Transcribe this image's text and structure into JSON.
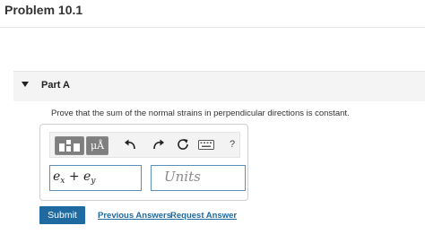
{
  "problem": {
    "title": "Problem 10.1"
  },
  "part": {
    "label": "Part A"
  },
  "question": {
    "text": "Prove that the sum of the normal strains in perpendicular directions is constant."
  },
  "toolbar": {
    "templates_icon": "templates-icon",
    "units_button_label": "μÅ",
    "undo_icon": "undo-icon",
    "redo_icon": "redo-icon",
    "reset_icon": "reset-icon",
    "keyboard_icon": "keyboard-icon",
    "help_label": "?"
  },
  "answer": {
    "expression": {
      "e1": "e",
      "s1": "x",
      "op": "+",
      "e2": "e",
      "s2": "y"
    },
    "units_placeholder": "Units"
  },
  "actions": {
    "submit_label": "Submit",
    "previous_answers_label": "Previous Answers",
    "request_answer_label": "Request Answer"
  },
  "colors": {
    "accent": "#1f6aa1",
    "toolbar_button": "#7f7f7f",
    "field_border": "#5b8fb9",
    "part_header_bg": "#f4f4f4"
  }
}
